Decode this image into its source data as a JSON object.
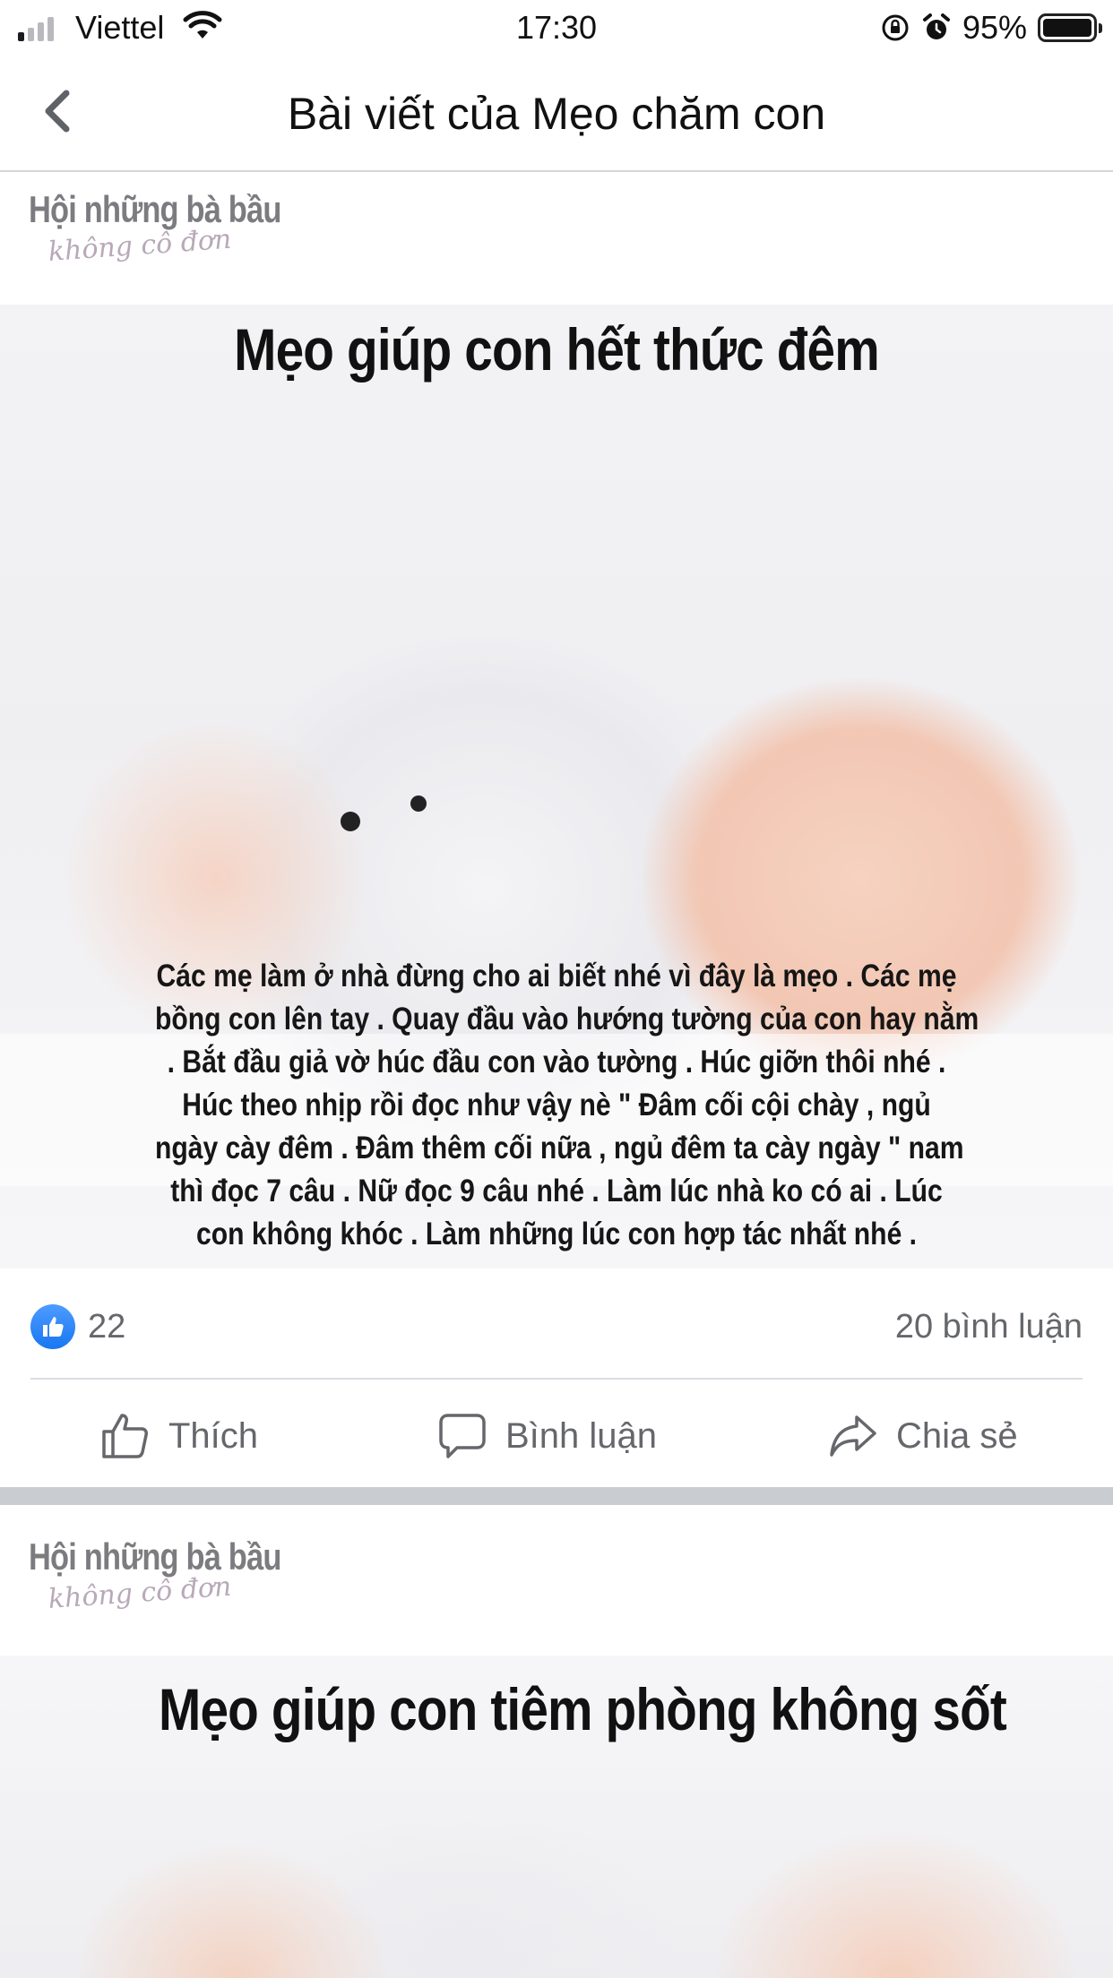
{
  "status_bar": {
    "carrier": "Viettel",
    "time": "17:30",
    "battery_percent": "95%",
    "signal_bars_active": 1,
    "signal_bars_total": 4
  },
  "header": {
    "title": "Bài viết của Mẹo chăm con"
  },
  "post1": {
    "watermark_title": "Hội những bà bầu",
    "watermark_subtitle": "không cô đơn",
    "headline": "Mẹo giúp con hết thức đêm",
    "caption_lines": [
      "Các mẹ làm ở nhà đừng cho ai biết nhé vì đây là mẹo . Các mẹ",
      "bồng con lên tay . Quay đầu vào hướng tường của con hay nằm",
      ". Bắt đầu giả vờ húc đầu con vào tường . Húc giỡn thôi nhé .",
      "Húc theo nhịp rồi đọc như vậy nè \" Đâm cối cội chày , ngủ",
      "ngày cày đêm . Đâm thêm cối nữa , ngủ đêm ta cày ngày \" nam",
      "thì đọc 7 câu . Nữ đọc 9 câu nhé . Làm lúc nhà ko có ai . Lúc",
      "con không khóc . Làm những lúc con hợp tác nhất nhé ."
    ],
    "like_count": "22",
    "comment_count": "20 bình luận"
  },
  "actions": {
    "like_label": "Thích",
    "comment_label": "Bình luận",
    "share_label": "Chia sẻ"
  },
  "post2": {
    "watermark_title": "Hội những bà bầu",
    "watermark_subtitle": "không cô đơn",
    "headline": "Mẹo giúp con tiêm phòng không sốt"
  },
  "colors": {
    "facebook_blue": "#1877f2",
    "secondary_text": "#65676b",
    "separator": "#c9ccd1"
  }
}
